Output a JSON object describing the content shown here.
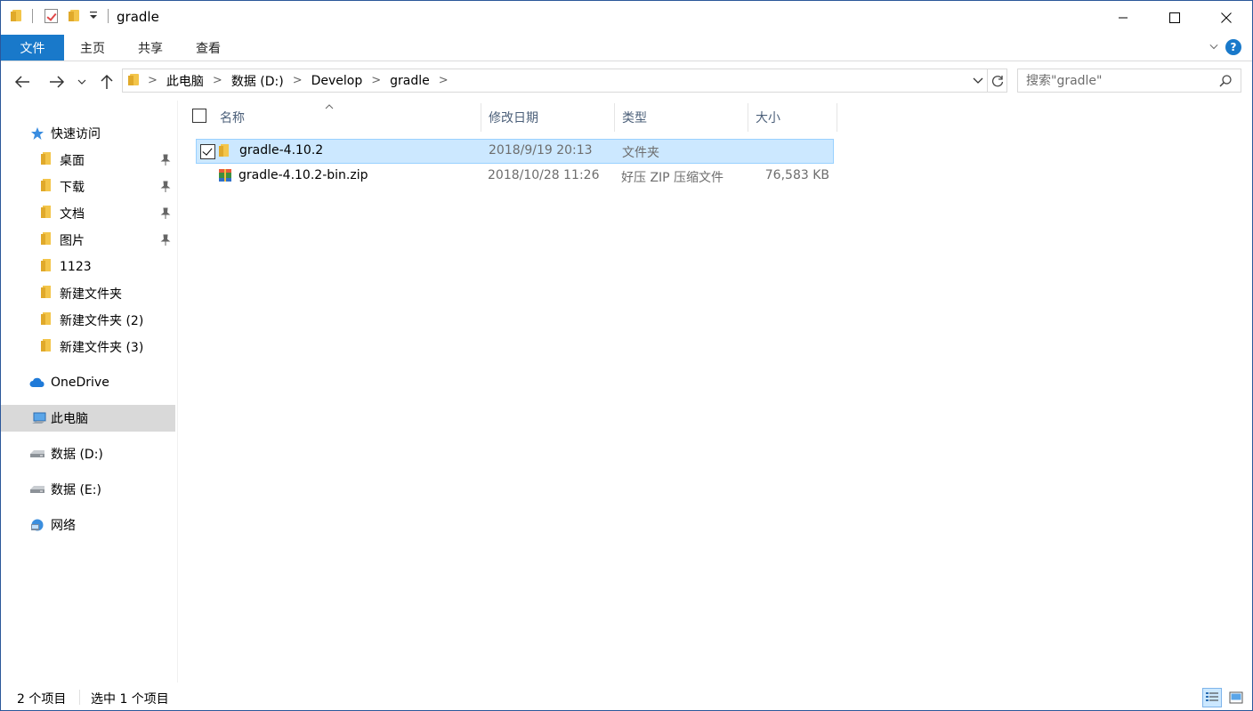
{
  "window": {
    "title": "gradle",
    "accent": "#1979ca"
  },
  "ribbon": {
    "tabs": [
      {
        "label": "文件",
        "active": true
      },
      {
        "label": "主页"
      },
      {
        "label": "共享"
      },
      {
        "label": "查看"
      }
    ]
  },
  "address": {
    "crumbs": [
      "此电脑",
      "数据 (D:)",
      "Develop",
      "gradle"
    ]
  },
  "search": {
    "placeholder": "搜索\"gradle\""
  },
  "sidebar": {
    "quick_access": "快速访问",
    "items": [
      {
        "label": "桌面",
        "pinned": true,
        "icon": "desktop-folder-icon"
      },
      {
        "label": "下载",
        "pinned": true,
        "icon": "downloads-folder-icon"
      },
      {
        "label": "文档",
        "pinned": true,
        "icon": "documents-folder-icon"
      },
      {
        "label": "图片",
        "pinned": true,
        "icon": "pictures-folder-icon"
      },
      {
        "label": "1123",
        "pinned": false,
        "icon": "folder-icon"
      },
      {
        "label": "新建文件夹",
        "pinned": false,
        "icon": "folder-icon"
      },
      {
        "label": "新建文件夹 (2)",
        "pinned": false,
        "icon": "folder-icon"
      },
      {
        "label": "新建文件夹 (3)",
        "pinned": false,
        "icon": "folder-icon"
      }
    ],
    "onedrive": "OneDrive",
    "this_pc": "此电脑",
    "drive_d": "数据 (D:)",
    "drive_e": "数据 (E:)",
    "network": "网络"
  },
  "columns": {
    "name": "名称",
    "date": "修改日期",
    "type": "类型",
    "size": "大小"
  },
  "files": [
    {
      "name": "gradle-4.10.2",
      "date": "2018/9/19 20:13",
      "type": "文件夹",
      "size": "",
      "selected": true,
      "icon": "folder-icon"
    },
    {
      "name": "gradle-4.10.2-bin.zip",
      "date": "2018/10/28 11:26",
      "type": "好压 ZIP 压缩文件",
      "size": "76,583 KB",
      "selected": false,
      "icon": "zip-archive-icon"
    }
  ],
  "status": {
    "count": "2 个项目",
    "selection": "选中 1 个项目"
  }
}
